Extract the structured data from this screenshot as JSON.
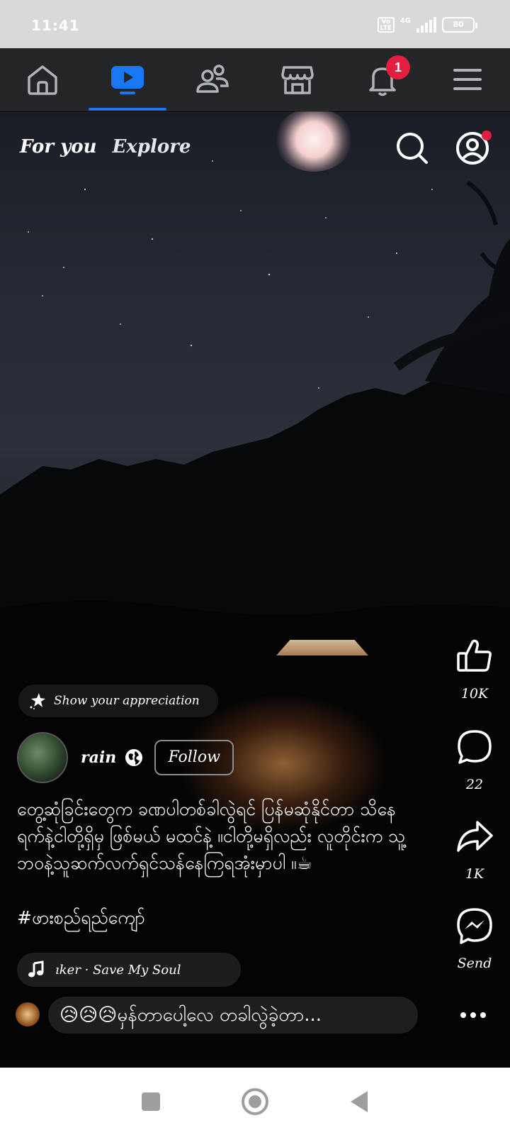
{
  "status_bar": {
    "time": "11:41",
    "volte": "Vo LTE",
    "network": "4G",
    "battery": "80"
  },
  "top_nav": {
    "items": [
      {
        "name": "home",
        "icon": "home-icon",
        "active": false
      },
      {
        "name": "video",
        "icon": "video-icon",
        "active": true
      },
      {
        "name": "friends",
        "icon": "friends-icon",
        "active": false
      },
      {
        "name": "marketplace",
        "icon": "marketplace-icon",
        "active": false
      },
      {
        "name": "notifications",
        "icon": "bell-icon",
        "active": false,
        "badge": "1"
      },
      {
        "name": "menu",
        "icon": "menu-icon",
        "active": false
      }
    ],
    "active_color": "#1877f2",
    "badge_color": "#e41e3f"
  },
  "feed": {
    "tabs": [
      "For you",
      "Explore"
    ],
    "appreciation_label": "Show your appreciation",
    "author": {
      "name": "rain",
      "follow_label": "Follow"
    },
    "caption": "တွေ့ဆုံခြင်းတွေက ခဏပါတစ်ခါလွဲရင် ပြန်မဆုံနိုင်တာ သိနေရက်နဲ့ငါတို့ရှိမှ ဖြစ်မယ် မထင်နဲ့ ။ငါတို့မရှိလည်း လူတိုင်းက သူ့ဘဝနဲ့သူဆက်လက်ရှင်သန်နေကြရအုံးမှာပါ ။☕",
    "hashtag": "#ဖားစည်ရည်ကျော်",
    "music": "ıker · Save My Soul",
    "comment": "😥😥😥မှန်တာပေါ့လေ တခါလွဲခဲ့တာ..."
  },
  "actions": {
    "like_count": "10K",
    "comment_count": "22",
    "share_count": "1K",
    "send_label": "Send"
  },
  "system_nav": {
    "buttons": [
      "recents",
      "home",
      "back"
    ]
  }
}
